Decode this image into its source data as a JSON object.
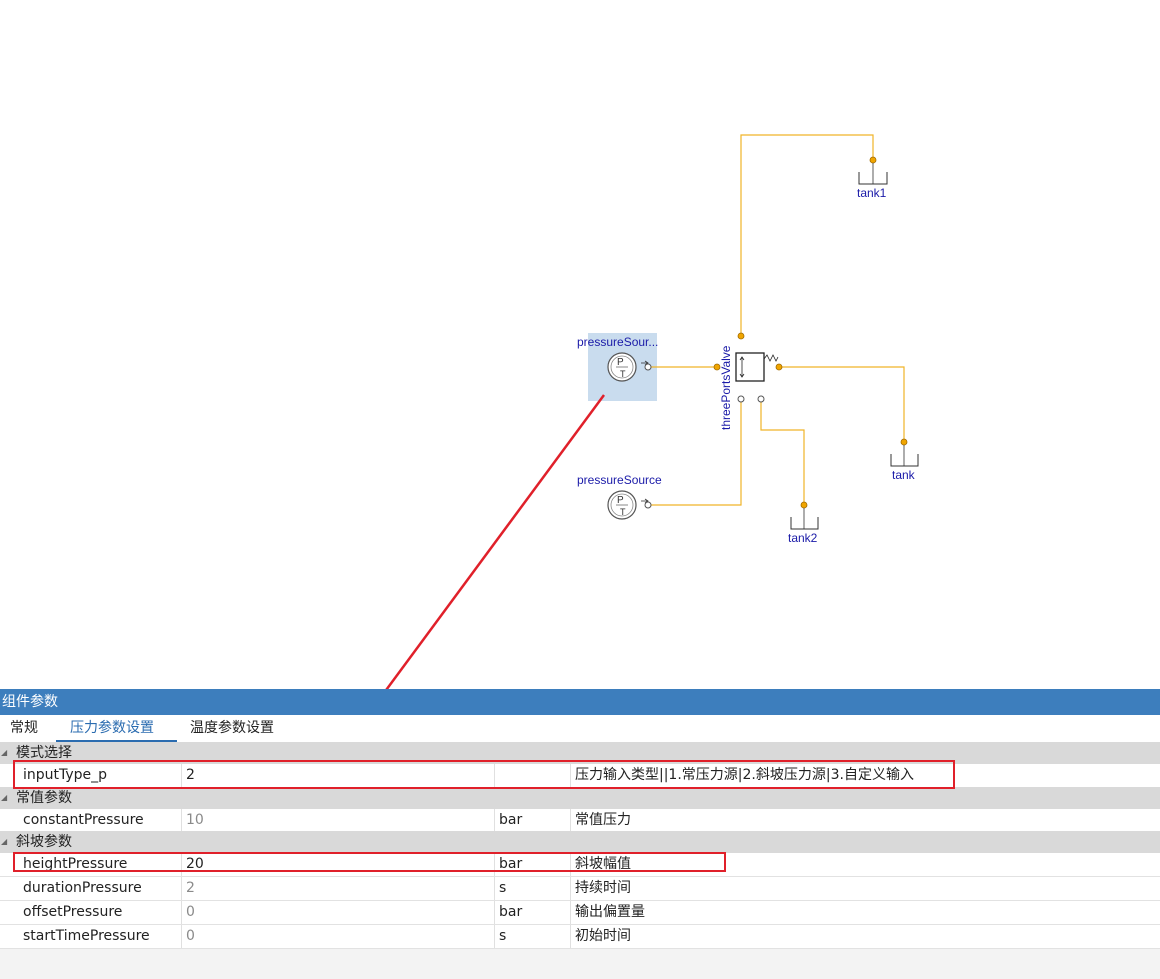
{
  "diagram": {
    "components": {
      "pressure_source_selected": "pressureSour...",
      "pressure_source": "pressureSource",
      "valve": "threePortsValve",
      "tank1": "tank1",
      "tank": "tank",
      "tank2": "tank2"
    }
  },
  "panel": {
    "title": "组件参数",
    "tabs": [
      "常规",
      "压力参数设置",
      "温度参数设置"
    ],
    "active_tab": "压力参数设置",
    "groups": [
      {
        "label": "模式选择",
        "rows": [
          {
            "name": "inputType_p",
            "value": "2",
            "unit": "",
            "desc": "压力输入类型||1.常压力源|2.斜坡压力源|3.自定义输入"
          }
        ]
      },
      {
        "label": "常值参数",
        "rows": [
          {
            "name": "constantPressure",
            "value": "10",
            "unit": "bar",
            "desc": "常值压力"
          }
        ]
      },
      {
        "label": "斜坡参数",
        "rows": [
          {
            "name": "heightPressure",
            "value": "20",
            "unit": "bar",
            "desc": "斜坡幅值"
          },
          {
            "name": "durationPressure",
            "value": "2",
            "unit": "s",
            "desc": "持续时间"
          },
          {
            "name": "offsetPressure",
            "value": "0",
            "unit": "bar",
            "desc": "输出偏置量"
          },
          {
            "name": "startTimePressure",
            "value": "0",
            "unit": "s",
            "desc": "初始时间"
          }
        ]
      }
    ]
  },
  "colors": {
    "wire": "#f0b429",
    "label": "#1a1aa8",
    "title_bar": "#3d7ebd",
    "highlight": "#e0202a",
    "selection": "#c9dcee"
  }
}
